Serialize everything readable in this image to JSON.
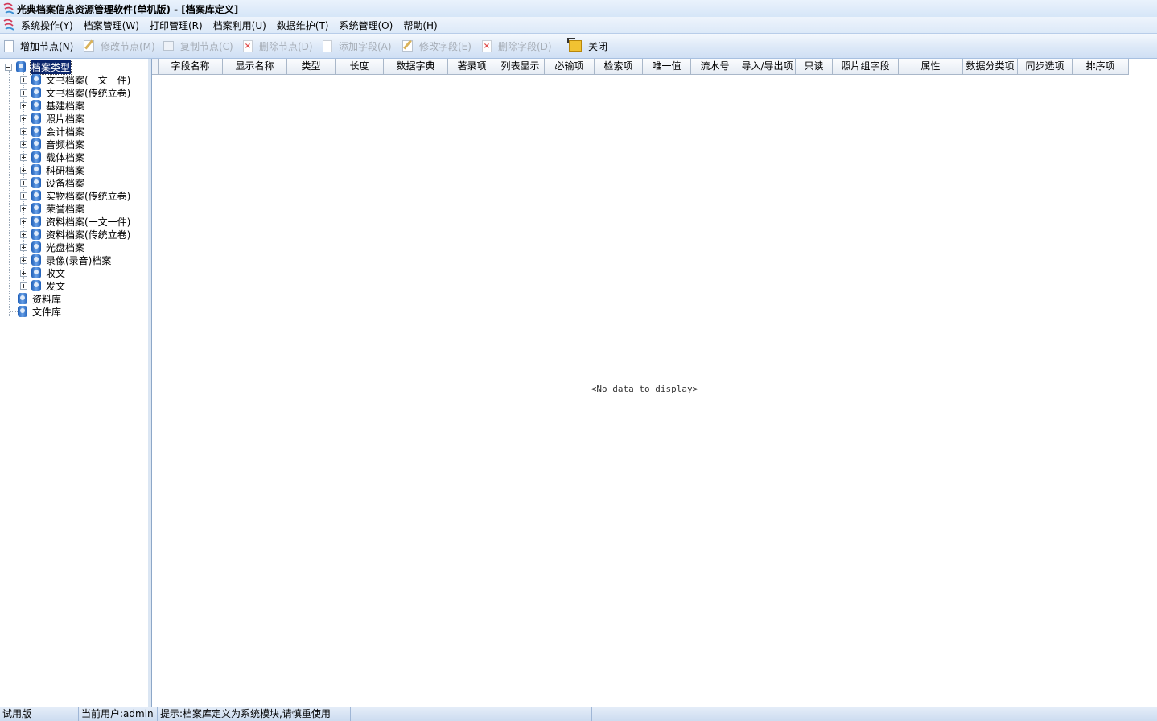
{
  "window": {
    "title": "光典档案信息资源管理软件(单机版) - [档案库定义]",
    "icon": "app-logo-icon"
  },
  "menu": {
    "items": [
      {
        "label": "系统操作(Y)"
      },
      {
        "label": "档案管理(W)"
      },
      {
        "label": "打印管理(R)"
      },
      {
        "label": "档案利用(U)"
      },
      {
        "label": "数据维护(T)"
      },
      {
        "label": "系统管理(O)"
      },
      {
        "label": "帮助(H)"
      }
    ]
  },
  "toolbar": {
    "add_node": "增加节点(N)",
    "edit_node": "修改节点(M)",
    "copy_node": "复制节点(C)",
    "delete_node": "删除节点(D)",
    "add_field": "添加字段(A)",
    "edit_field": "修改字段(E)",
    "delete_field": "删除字段(D)",
    "close": "关闭"
  },
  "tree": {
    "root": "档案类型",
    "children": [
      "文书档案(一文一件)",
      "文书档案(传统立卷)",
      "基建档案",
      "照片档案",
      "会计档案",
      "音频档案",
      "载体档案",
      "科研档案",
      "设备档案",
      "实物档案(传统立卷)",
      "荣誉档案",
      "资料档案(一文一件)",
      "资料档案(传统立卷)",
      "光盘档案",
      "录像(录音)档案",
      "收文",
      "发文"
    ],
    "siblings": [
      "资料库",
      "文件库"
    ]
  },
  "grid": {
    "columns": [
      "字段名称",
      "显示名称",
      "类型",
      "长度",
      "数据字典",
      "著录项",
      "列表显示",
      "必输项",
      "检索项",
      "唯一值",
      "流水号",
      "导入/导出项",
      "只读",
      "照片组字段",
      "属性",
      "数据分类项",
      "同步选项",
      "排序项"
    ],
    "empty_text": "<No data to display>"
  },
  "status": {
    "edition": "试用版",
    "user": "当前用户:admin",
    "hint": "提示:档案库定义为系统模块,请慎重使用"
  },
  "colors": {
    "accent": "#0a246a",
    "toolbar_bg": "#dfeaf8",
    "disabled_text": "#a6adb6"
  }
}
